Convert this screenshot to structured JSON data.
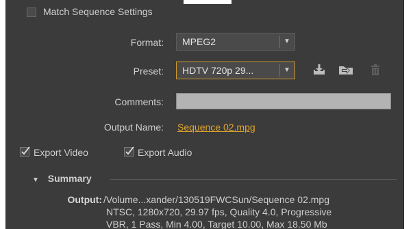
{
  "match_sequence": {
    "label": "Match Sequence Settings",
    "checked": false
  },
  "format": {
    "label": "Format:",
    "value": "MPEG2",
    "arrow": "▼"
  },
  "preset": {
    "label": "Preset:",
    "value": "HDTV 720p 29...",
    "arrow": "▼",
    "icons": [
      "save-preset-icon",
      "import-preset-icon",
      "delete-preset-icon"
    ]
  },
  "comments": {
    "label": "Comments:",
    "value": ""
  },
  "output_name": {
    "label": "Output Name:",
    "value": "Sequence 02.mpg"
  },
  "export_video": {
    "label": "Export Video",
    "checked": true
  },
  "export_audio": {
    "label": "Export Audio",
    "checked": true
  },
  "summary": {
    "header": "Summary",
    "toggle": "▼",
    "output_label": "Output:",
    "output_lines": [
      "/Volume...xander/130519FWCSun/Sequence 02.mpg",
      "NTSC, 1280x720, 29.97 fps, Quality 4.0, Progressive",
      "VBR, 1 Pass, Min 4.00, Target 10.00, Max 18.50 Mb"
    ]
  },
  "colors": {
    "panel": "#3b3b3b",
    "accent": "#e2a62c",
    "focus_border": "#d39a2a"
  }
}
